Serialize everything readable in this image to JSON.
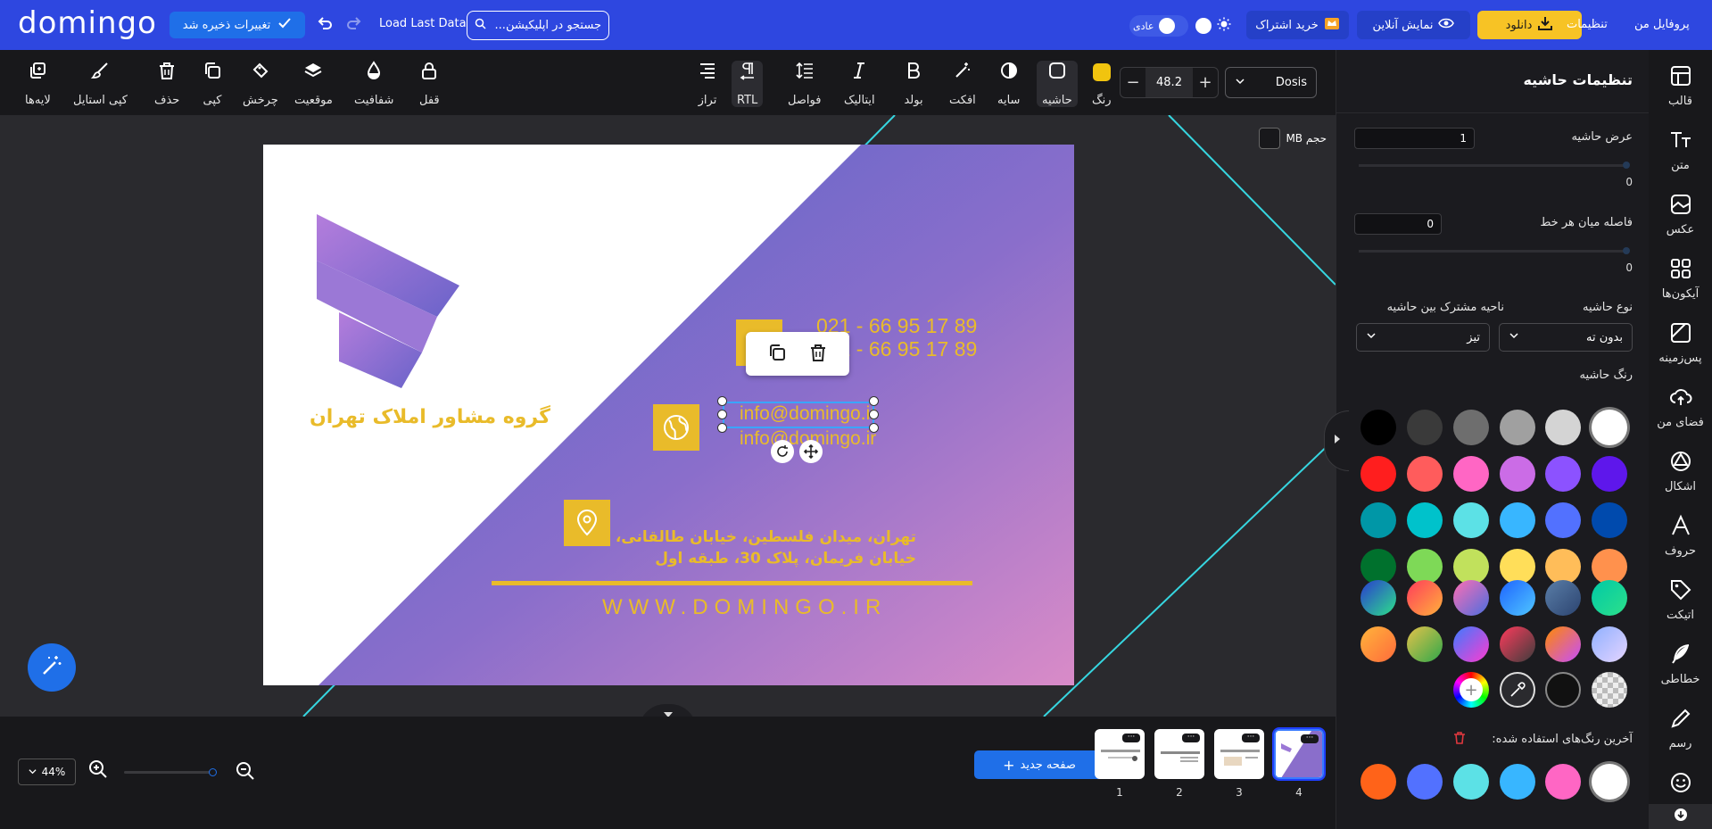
{
  "topbar": {
    "logo": "domingo",
    "saved_label": "تغییرات ذخیره شد",
    "load_last": "Load Last Data",
    "search_placeholder": "جستجو در اپلیکیشن...",
    "mode_label": "عادی",
    "buy_label": "خرید اشتراک",
    "online_label": "نمایش آنلاین",
    "download_label": "دانلود",
    "settings_label": "تنظیمات",
    "profile_label": "پروفایل من"
  },
  "toolbar": {
    "font": "Dosis",
    "font_size": "48.2",
    "tools": {
      "color": "رنگ",
      "border": "حاشیه",
      "shadow": "سایه",
      "effect": "افکت",
      "bold": "بولد",
      "italic": "ایتالیک",
      "spacing": "فواصل",
      "rtl": "RTL",
      "align": "تراز",
      "lock": "قفل",
      "opacity": "شفافیت",
      "position": "موقعیت",
      "rotate": "چرخش",
      "copy": "کپی",
      "delete": "حذف",
      "copy_style": "کپی استایل",
      "layers": "لایه‌ها"
    }
  },
  "canvas": {
    "mb_label": "حجم MB",
    "card": {
      "company": "گروه مشاور املاک تهران",
      "phone1": "021 - 66 95 17 89",
      "phone2": "021 - 66 95 17 89",
      "email1": "info@domingo.ir",
      "email2": "info@domingo.ir",
      "address1": "تهران، میدان فلسطین، خیابان طالقانی،",
      "address2": "خیابان فریمان، پلاک 30، طبقه اول",
      "website": "WWW.DOMINGO.IR"
    }
  },
  "bottom": {
    "zoom": "44%",
    "new_page": "صفحه جدید",
    "pages": [
      "1",
      "2",
      "3",
      "4"
    ],
    "active_page": "4"
  },
  "panel": {
    "title": "تنظیمات حاشیه",
    "border_width_label": "عرض حاشیه",
    "border_width_value": "1",
    "border_width_slider_text": "0",
    "line_spacing_label": "فاصله میان هر خط",
    "line_spacing_value": "0",
    "line_spacing_slider_text": "0",
    "border_type_label": "نوع حاشیه",
    "border_type_value": "بدون ته",
    "join_label": "ناحیه مشترک بین حاشیه",
    "join_value": "تیز",
    "border_color_label": "رنگ حاشیه",
    "recent_label": "آخرین رنگ‌های استفاده شده:",
    "swatches": [
      [
        "#000000",
        "#3a3a3a",
        "#6e6e6e",
        "#a0a0a0",
        "#d4d4d4",
        "#ffffff"
      ],
      [
        "#ff1e1e",
        "#ff5c5c",
        "#ff66c4",
        "#cb6ce6",
        "#8c52ff",
        "#5e17eb"
      ],
      [
        "#0097a7",
        "#00c2cb",
        "#5ce1e6",
        "#38b6ff",
        "#5271ff",
        "#004aad"
      ],
      [
        "#00712d",
        "#7ed957",
        "#c1e15c",
        "#ffde59",
        "#ffbd59",
        "#ff914d"
      ]
    ],
    "recent_colors": [
      "#ffffff",
      "#ff66c4",
      "#38b6ff",
      "#5ce1e6",
      "#5271ff",
      "#ff6319"
    ]
  },
  "sidebar": {
    "items": [
      "قالب",
      "متن",
      "عکس",
      "آیکون‌ها",
      "پس‌زمینه",
      "فضای من",
      "اشکال",
      "حروف",
      "اتیکت",
      "خطاطی",
      "رسم"
    ]
  },
  "colors": {
    "brand_blue": "#2e47e0",
    "download_yellow": "#f7c325",
    "accent_gold": "#e9bb2a",
    "primary": "#1f6fe8"
  }
}
